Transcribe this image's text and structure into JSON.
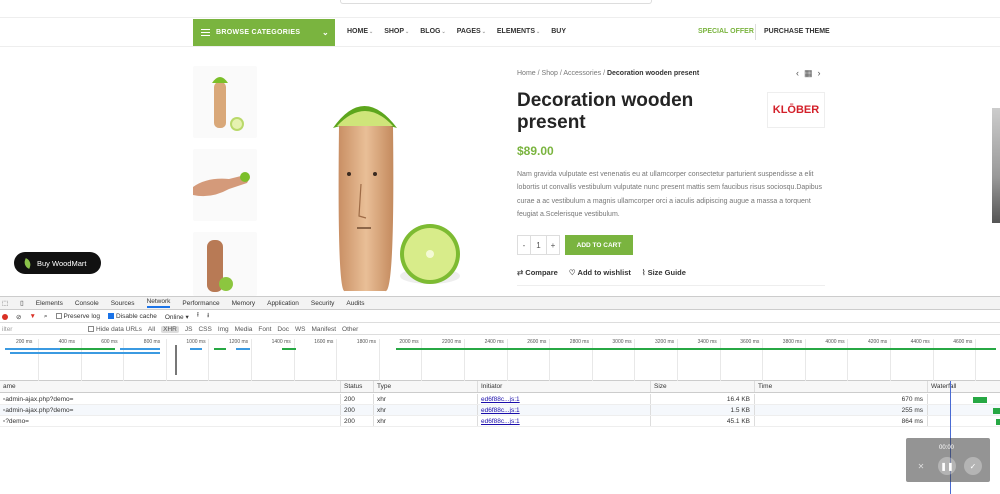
{
  "header": {
    "browse_label": "BROWSE CATEGORIES",
    "nav": [
      {
        "label": "HOME"
      },
      {
        "label": "SHOP"
      },
      {
        "label": "BLOG"
      },
      {
        "label": "PAGES"
      },
      {
        "label": "ELEMENTS"
      },
      {
        "label": "BUY"
      }
    ],
    "special_offer": "SPECIAL OFFER",
    "purchase_theme": "PURCHASE THEME"
  },
  "breadcrumb": {
    "home": "Home",
    "shop": "Shop",
    "accessories": "Accessories",
    "current": "Decoration wooden present",
    "separator": "/"
  },
  "product": {
    "title": "Decoration wooden present",
    "brand": "KLŌBER",
    "price": "$89.00",
    "description": "Nam gravida vulputate est venenatis eu at ullamcorper consectetur parturient suspendisse a elit lobortis ut convallis vestibulum vulputate nunc present mattis sem faucibus risus sociosqu.Dapibus curae a ac vestibulum a magnis ullamcorper orci a iaculis adipiscing augue a massa a torquent feugiat a.Scelerisque vestibulum.",
    "qty_minus": "-",
    "qty": "1",
    "qty_plus": "+",
    "add_to_cart": "ADD TO CART",
    "compare": "Compare",
    "wishlist": "Add to wishlist",
    "size_guide": "Size Guide"
  },
  "buy_woodmart": "Buy WoodMart",
  "devtools": {
    "tabs": [
      "Elements",
      "Console",
      "Sources",
      "Network",
      "Performance",
      "Memory",
      "Application",
      "Security",
      "Audits"
    ],
    "active_tab": "Network",
    "toolbar": {
      "preserve_log": "Preserve log",
      "disable_cache": "Disable cache",
      "throttle": "Online"
    },
    "filter": {
      "placeholder": "ilter",
      "hide_data_urls": "Hide data URLs",
      "types": [
        "All",
        "XHR",
        "JS",
        "CSS",
        "Img",
        "Media",
        "Font",
        "Doc",
        "WS",
        "Manifest",
        "Other"
      ],
      "active_type": "XHR"
    },
    "ticks": [
      "200 ms",
      "400 ms",
      "600 ms",
      "800 ms",
      "1000 ms",
      "1200 ms",
      "1400 ms",
      "1600 ms",
      "1800 ms",
      "2000 ms",
      "2200 ms",
      "2400 ms",
      "2600 ms",
      "2800 ms",
      "3000 ms",
      "3200 ms",
      "3400 ms",
      "3600 ms",
      "3800 ms",
      "4000 ms",
      "4200 ms",
      "4400 ms",
      "4600 ms"
    ],
    "columns": {
      "name": "ame",
      "status": "Status",
      "type": "Type",
      "initiator": "Initiator",
      "size": "Size",
      "time": "Time",
      "waterfall": "Waterfall"
    },
    "rows": [
      {
        "name": "admin-ajax.php?demo=",
        "status": "200",
        "type": "xhr",
        "initiator": "ed6f88c...js:1",
        "size": "16.4 KB",
        "time": "670 ms"
      },
      {
        "name": "admin-ajax.php?demo=",
        "status": "200",
        "type": "xhr",
        "initiator": "ed6f88c...js:1",
        "size": "1.5 KB",
        "time": "255 ms"
      },
      {
        "name": "?demo=",
        "status": "200",
        "type": "xhr",
        "initiator": "ed6f88c...js:1",
        "size": "45.1 KB",
        "time": "864 ms"
      }
    ]
  },
  "recorder": {
    "time": "00:00"
  }
}
